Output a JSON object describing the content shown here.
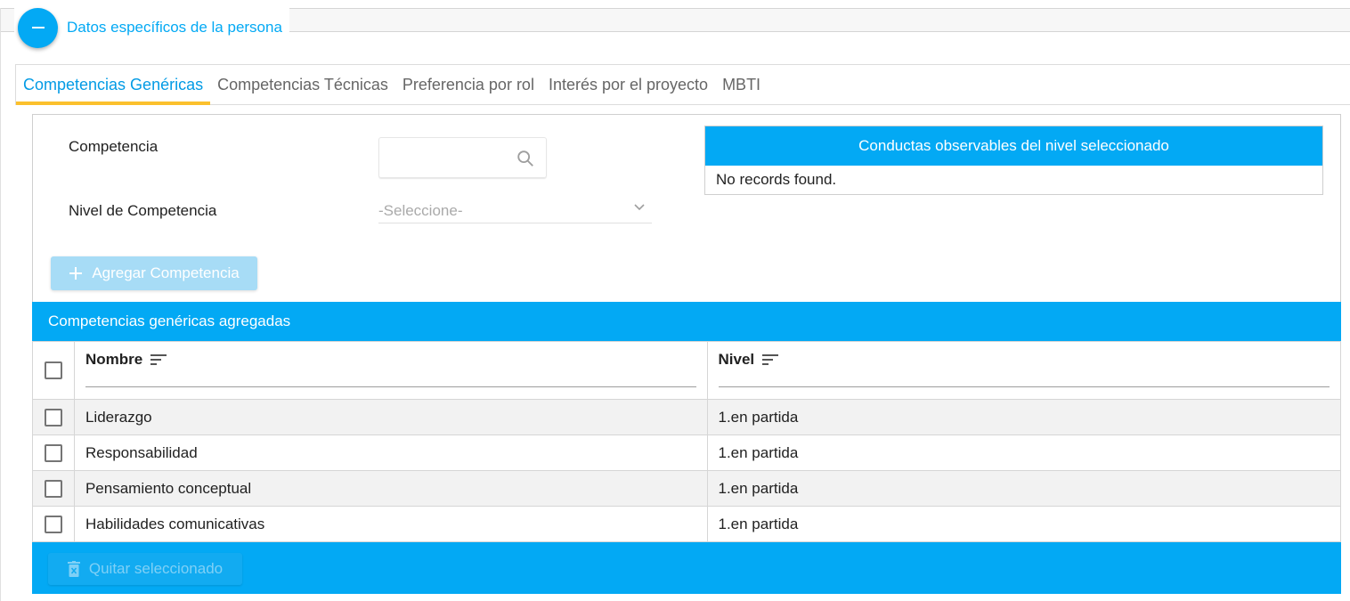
{
  "fieldset": {
    "legend": "Datos específicos de la persona"
  },
  "tabs": [
    {
      "label": "Competencias Genéricas",
      "active": true
    },
    {
      "label": "Competencias Técnicas",
      "active": false
    },
    {
      "label": "Preferencia por rol",
      "active": false
    },
    {
      "label": "Interés por el proyecto",
      "active": false
    },
    {
      "label": "MBTI",
      "active": false
    }
  ],
  "form": {
    "competencia_label": "Competencia",
    "competencia_value": "",
    "nivel_label": "Nivel de Competencia",
    "nivel_value": "-Seleccione-",
    "add_button": "Agregar Competencia"
  },
  "conductas": {
    "title": "Conductas observables del nivel seleccionado",
    "empty_message": "No records found."
  },
  "table": {
    "title": "Competencias genéricas agregadas",
    "columns": [
      "Nombre",
      "Nivel"
    ],
    "rows": [
      {
        "nombre": "Liderazgo",
        "nivel": "1.en partida"
      },
      {
        "nombre": "Responsabilidad",
        "nivel": "1.en partida"
      },
      {
        "nombre": "Pensamiento conceptual",
        "nivel": "1.en partida"
      },
      {
        "nombre": "Habilidades comunicativas",
        "nivel": "1.en partida"
      }
    ],
    "remove_button": "Quitar seleccionado"
  },
  "colors": {
    "primary": "#03a9f4",
    "tab_indicator": "#fbc02d",
    "disabled_button": "#a7dcf6"
  }
}
